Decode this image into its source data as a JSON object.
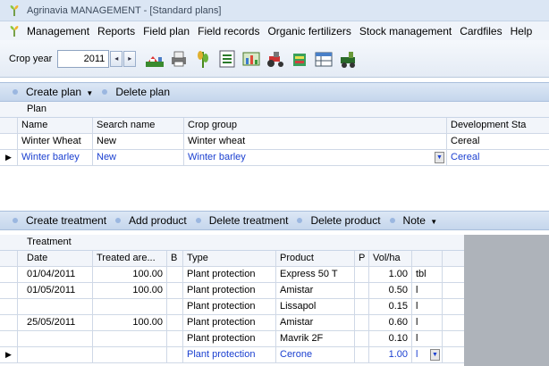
{
  "window": {
    "title": "Agrinavia MANAGEMENT - [Standard plans]"
  },
  "menu": {
    "items": [
      "Management",
      "Reports",
      "Field plan",
      "Field records",
      "Organic fertilizers",
      "Stock management",
      "Cardfiles",
      "Help"
    ]
  },
  "toolbar": {
    "crop_year_label": "Crop year",
    "crop_year_value": "2011",
    "spin_left": "◂",
    "spin_right": "▸",
    "icons": [
      "farm-icon",
      "printer-icon",
      "crop-icon",
      "list-icon",
      "chart-icon",
      "tractor-icon",
      "fertilizer-icon",
      "table-icon",
      "machine-icon"
    ]
  },
  "plan_bar": {
    "create_label": "Create plan",
    "create_caret": "▼",
    "delete_label": "Delete plan"
  },
  "plan_grid": {
    "group_label": "Plan",
    "columns": [
      "Name",
      "Search name",
      "Crop group",
      "Development Sta"
    ],
    "rows": [
      {
        "name": "Winter Wheat",
        "search": "New",
        "crop": "Winter wheat",
        "dev": "Cereal"
      },
      {
        "name": "Winter barley",
        "search": "New",
        "crop": "Winter barley",
        "dev": "Cereal"
      }
    ],
    "row_marker": "▶",
    "dropdown_glyph": "▼"
  },
  "treatment_bar": {
    "create_label": "Create treatment",
    "add_label": "Add product",
    "delete_label": "Delete treatment",
    "delete_product_label": "Delete product",
    "note_label": "Note",
    "note_caret": "▼"
  },
  "treatment_grid": {
    "group_label": "Treatment",
    "columns": [
      "Date",
      "Treated are...",
      "B",
      "Type",
      "Product",
      "P",
      "Vol/ha",
      ""
    ],
    "rows": [
      {
        "date": "01/04/2011",
        "area": "100.00",
        "type": "Plant protection",
        "product": "Express 50 T",
        "vol": "1.00",
        "unit": "tbl"
      },
      {
        "date": "01/05/2011",
        "area": "100.00",
        "type": "Plant protection",
        "product": "Amistar",
        "vol": "0.50",
        "unit": "l"
      },
      {
        "date": "",
        "area": "",
        "type": "Plant protection",
        "product": "Lissapol",
        "vol": "0.15",
        "unit": "l"
      },
      {
        "date": "25/05/2011",
        "area": "100.00",
        "type": "Plant protection",
        "product": "Amistar",
        "vol": "0.60",
        "unit": "l"
      },
      {
        "date": "",
        "area": "",
        "type": "Plant protection",
        "product": "Mavrik 2F",
        "vol": "0.10",
        "unit": "l"
      },
      {
        "date": "",
        "area": "",
        "type": "Plant protection",
        "product": "Cerone",
        "vol": "1.00",
        "unit": "l"
      }
    ],
    "row_marker": "▶",
    "dropdown_glyph": "▼"
  },
  "colors": {
    "accent": "#1a3fd0",
    "bar": "#c5d6ec",
    "title": "#dbe6f4"
  }
}
